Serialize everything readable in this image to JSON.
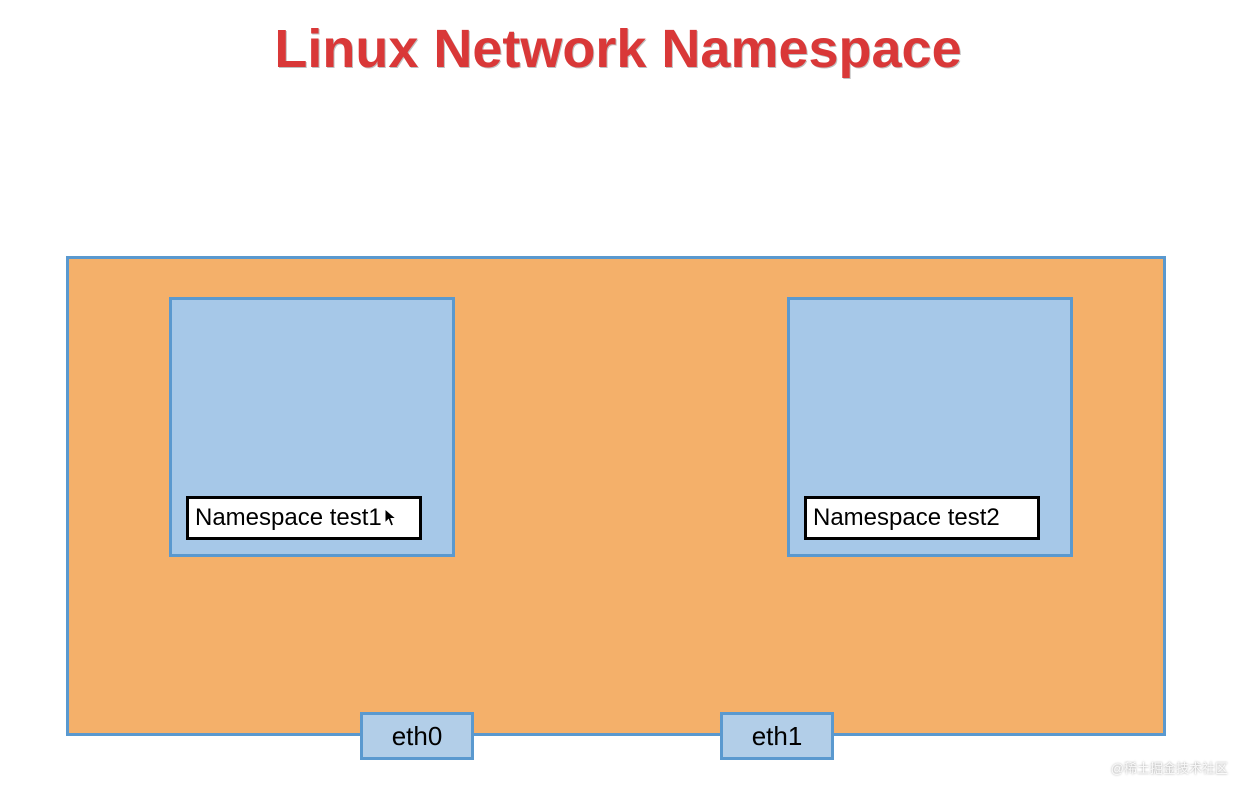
{
  "title": "Linux Network Namespace",
  "namespaces": {
    "left": {
      "label": "Namespace test1"
    },
    "right": {
      "label": "Namespace test2"
    }
  },
  "interfaces": {
    "eth0": "eth0",
    "eth1": "eth1"
  },
  "colors": {
    "title": "#d93838",
    "host_fill": "#f4b06a",
    "ns_fill": "#a6c8e8",
    "border": "#5a99cf"
  },
  "watermark": "@稀土掘金技术社区"
}
